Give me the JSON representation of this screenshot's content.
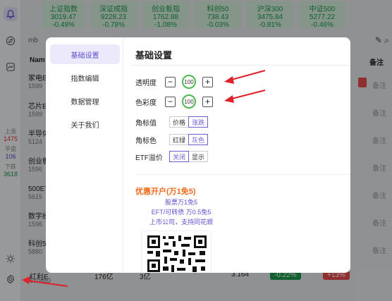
{
  "rail": {
    "stats": [
      {
        "label": "上涨",
        "value": "1475"
      },
      {
        "label": "平盘",
        "value": "106"
      },
      {
        "label": "下跌",
        "value": "3618"
      }
    ]
  },
  "indices": [
    {
      "name": "上证指数",
      "value": "3019.47",
      "pct": "-0.49%"
    },
    {
      "name": "深证成指",
      "value": "9228.23",
      "pct": "-0.78%"
    },
    {
      "name": "创业板指",
      "value": "1762.88",
      "pct": "-1.08%"
    },
    {
      "name": "科创50",
      "value": "738.43",
      "pct": "-0.03%"
    },
    {
      "name": "沪深300",
      "value": "3475.84",
      "pct": "-0.81%"
    },
    {
      "name": "中证500",
      "value": "5277.22",
      "pct": "-0.46%"
    }
  ],
  "background": {
    "toolbar_text": "mb",
    "col_name": "Nam",
    "col_note": "备注",
    "rows": [
      {
        "name": "家电E",
        "code": "1599"
      },
      {
        "name": "芯片E",
        "code": "1599"
      },
      {
        "name": "半导体",
        "code": "5124"
      },
      {
        "name": "创业板",
        "code": "1596"
      },
      {
        "name": "500ET",
        "code": "5615"
      },
      {
        "name": "数字经",
        "code": "1596"
      },
      {
        "name": "科创5",
        "code": "5880"
      }
    ],
    "note_text": "备注",
    "last_row": {
      "name": "红利E",
      "code": "510880",
      "amount": "176亿",
      "shares": "3亿",
      "price": "3.164",
      "chg_a": "-0.22%",
      "chg_b": "+13%"
    }
  },
  "modal": {
    "nav": [
      "基础设置",
      "指数编辑",
      "数据管理",
      "关于我们"
    ],
    "title": "基础设置",
    "opacity": {
      "label": "透明度",
      "value": "100",
      "minus": "−",
      "plus": "+"
    },
    "saturation": {
      "label": "色彩度",
      "value": "100",
      "minus": "−",
      "plus": "+"
    },
    "corner_value": {
      "label": "角标值",
      "options": [
        "价格",
        "涨跌"
      ],
      "selected": "涨跌"
    },
    "corner_color": {
      "label": "角标色",
      "options": [
        "红绿",
        "灰色"
      ],
      "selected": "灰色"
    },
    "etf_premium": {
      "label": "ETF溢价",
      "options": [
        "关闭",
        "显示"
      ],
      "selected": "关闭"
    },
    "promo": {
      "title": "优惠开户(万1免5)",
      "lines": [
        "股票万1免5",
        "EFT/可转债 万0.5免5",
        "上市公司，支持同花顺"
      ]
    }
  },
  "colors": {
    "accent": "#5a4fcf",
    "green": "#4cbb4c",
    "red_arrow": "#e0202a",
    "promo_orange": "#f06a1b"
  }
}
